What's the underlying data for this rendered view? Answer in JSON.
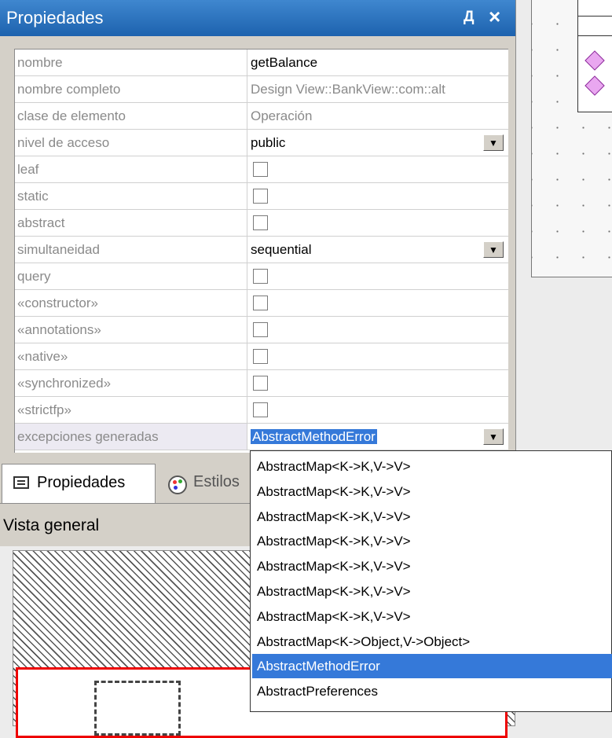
{
  "panel": {
    "title": "Propiedades",
    "pin_glyph": "Д",
    "close_glyph": "×"
  },
  "properties": [
    {
      "name": "nombre",
      "value": "getBalance",
      "type": "text"
    },
    {
      "name": "nombre completo",
      "value": "Design View::BankView::com::alt",
      "type": "readonly"
    },
    {
      "name": "clase de elemento",
      "value": "Operación",
      "type": "readonly"
    },
    {
      "name": "nivel de acceso",
      "value": "public",
      "type": "dropdown"
    },
    {
      "name": "leaf",
      "type": "checkbox",
      "checked": false
    },
    {
      "name": "static",
      "type": "checkbox",
      "checked": false
    },
    {
      "name": "abstract",
      "type": "checkbox",
      "checked": false
    },
    {
      "name": "simultaneidad",
      "value": "sequential",
      "type": "dropdown"
    },
    {
      "name": "query",
      "type": "checkbox",
      "checked": false
    },
    {
      "name": "«constructor»",
      "type": "checkbox",
      "checked": false
    },
    {
      "name": "«annotations»",
      "type": "checkbox",
      "checked": false
    },
    {
      "name": "«native»",
      "type": "checkbox",
      "checked": false
    },
    {
      "name": "«synchronized»",
      "type": "checkbox",
      "checked": false
    },
    {
      "name": "«strictfp»",
      "type": "checkbox",
      "checked": false
    },
    {
      "name": "excepciones generadas",
      "value": "AbstractMethodError",
      "type": "dropdown",
      "active": true
    }
  ],
  "tabs": [
    {
      "label": "Propiedades",
      "icon": "properties-icon",
      "active": true
    },
    {
      "label": "Estilos",
      "icon": "palette-icon",
      "active": false
    }
  ],
  "overview": {
    "title": "Vista general"
  },
  "dropdown": {
    "items": [
      "AbstractMap<K->K,V->V>",
      "AbstractMap<K->K,V->V>",
      "AbstractMap<K->K,V->V>",
      "AbstractMap<K->K,V->V>",
      "AbstractMap<K->K,V->V>",
      "AbstractMap<K->K,V->V>",
      "AbstractMap<K->K,V->V>",
      "AbstractMap<K->Object,V->Object>",
      "AbstractMethodError",
      "AbstractPreferences"
    ],
    "selected_index": 8
  },
  "colors": {
    "titlebar": "#1d62ae",
    "selection": "#3579d9",
    "overview_view_border": "#e00000",
    "operation_icon": "#e9a7f0"
  }
}
